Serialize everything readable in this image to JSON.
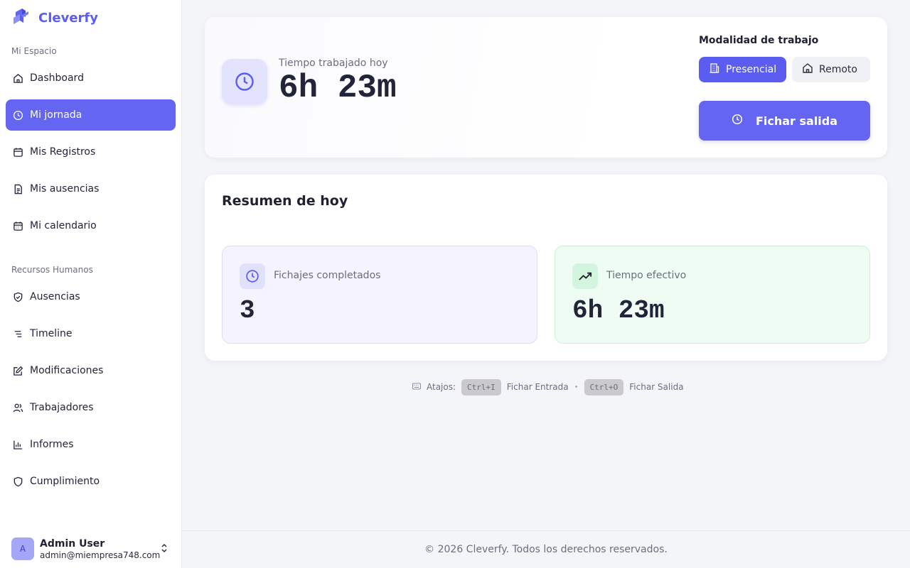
{
  "brand": {
    "name": "Cleverfy",
    "accent": "#5b5cf0"
  },
  "sidebar": {
    "section_personal": "Mi Espacio",
    "personal_items": [
      {
        "label": "Dashboard",
        "icon": "home-icon"
      },
      {
        "label": "Mi jornada",
        "icon": "clock-icon",
        "active": true
      },
      {
        "label": "Mis Registros",
        "icon": "calendar-icon"
      },
      {
        "label": "Mis ausencias",
        "icon": "document-icon"
      },
      {
        "label": "Mi calendario",
        "icon": "calendar-grid-icon"
      }
    ],
    "section_hr": "Recursos Humanos",
    "hr_items": [
      {
        "label": "Ausencias",
        "icon": "shield-check-icon"
      },
      {
        "label": "Timeline",
        "icon": "timeline-icon"
      },
      {
        "label": "Modificaciones",
        "icon": "edit-icon"
      },
      {
        "label": "Trabajadores",
        "icon": "users-icon"
      },
      {
        "label": "Informes",
        "icon": "bar-chart-icon"
      },
      {
        "label": "Cumplimiento",
        "icon": "shield-icon"
      }
    ],
    "user": {
      "initial": "A",
      "name": "Admin User",
      "email": "admin@miempresa748.com"
    }
  },
  "timer": {
    "label": "Tiempo trabajado hoy",
    "value": "6h 23m"
  },
  "work_mode": {
    "title": "Modalidad de trabajo",
    "options": [
      {
        "label": "Presencial",
        "icon": "building-icon",
        "selected": true
      },
      {
        "label": "Remoto",
        "icon": "home-icon",
        "selected": false
      }
    ]
  },
  "clock_out": {
    "label": "Fichar salida"
  },
  "summary": {
    "title": "Resumen de hoy",
    "stats": [
      {
        "label": "Fichajes completados",
        "value": "3",
        "icon": "clock-icon",
        "color": "#5b5cf0"
      },
      {
        "label": "Tiempo efectivo",
        "value": "6h 23m",
        "icon": "trending-up-icon",
        "color": "#1f8a4c"
      }
    ]
  },
  "shortcuts": {
    "label": "Atajos:",
    "items": [
      {
        "key": "Ctrl+I",
        "action": "Fichar Entrada"
      },
      {
        "key": "Ctrl+O",
        "action": "Fichar Salida"
      }
    ]
  },
  "footer": {
    "text": "© 2026 Cleverfy. Todos los derechos reservados."
  }
}
